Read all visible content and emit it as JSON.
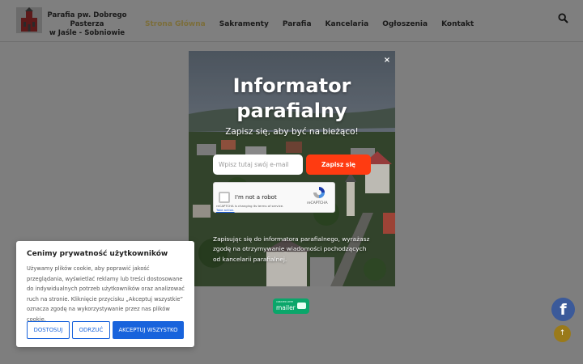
{
  "header": {
    "brand_line1": "Parafia pw. Dobrego Pasterza",
    "brand_line2": "w Jaśle - Sobniowie",
    "nav": [
      "Strona Główna",
      "Sakramenty",
      "Parafia",
      "Kancelaria",
      "Ogłoszenia",
      "Kontakt"
    ],
    "active_nav": "Strona Główna",
    "search_icon": "search-icon"
  },
  "modal": {
    "close": "×",
    "title_line1": "Informator",
    "title_line2": "parafialny",
    "subtitle": "Zapisz się, aby być na bieżąco!",
    "email_placeholder": "Wpisz tutaj swój e-mail",
    "subscribe_label": "Zapisz się",
    "captcha": {
      "label": "I'm not a robot",
      "brand": "reCAPTCHA",
      "note_line1": "reCAPTCHA is changing its terms of service.",
      "note_link": "Take action."
    },
    "footer_text": "Zapisując się do informatora parafialnego, wyrażasz zgodę na otrzymywanie wiadomości pochodzących od kancelarii parafialnej."
  },
  "mailer_badge": {
    "small": "CREATED WITH",
    "name": "mailer"
  },
  "cookie": {
    "title": "Cenimy prywatność użytkowników",
    "text": "Używamy plików cookie, aby poprawić jakość przeglądania, wyświetlać reklamy lub treści dostosowane do indywidualnych potrzeb użytkowników oraz analizować ruch na stronie. Kliknięcie przycisku „Akceptuj wszystkie” oznacza zgodę na wykorzystywanie przez nas plików cookie.",
    "buttons": {
      "customize": "DOSTOSUJ",
      "reject": "ODRZUĆ",
      "accept": "AKCEPTUJ WSZYSTKO"
    }
  },
  "floating": {
    "facebook": "f",
    "to_top": "↑"
  },
  "colors": {
    "subscribe": "#ff3b11",
    "cookie_accent": "#1863dc",
    "mailer": "#0aa66a",
    "facebook": "#3b5a9a"
  }
}
